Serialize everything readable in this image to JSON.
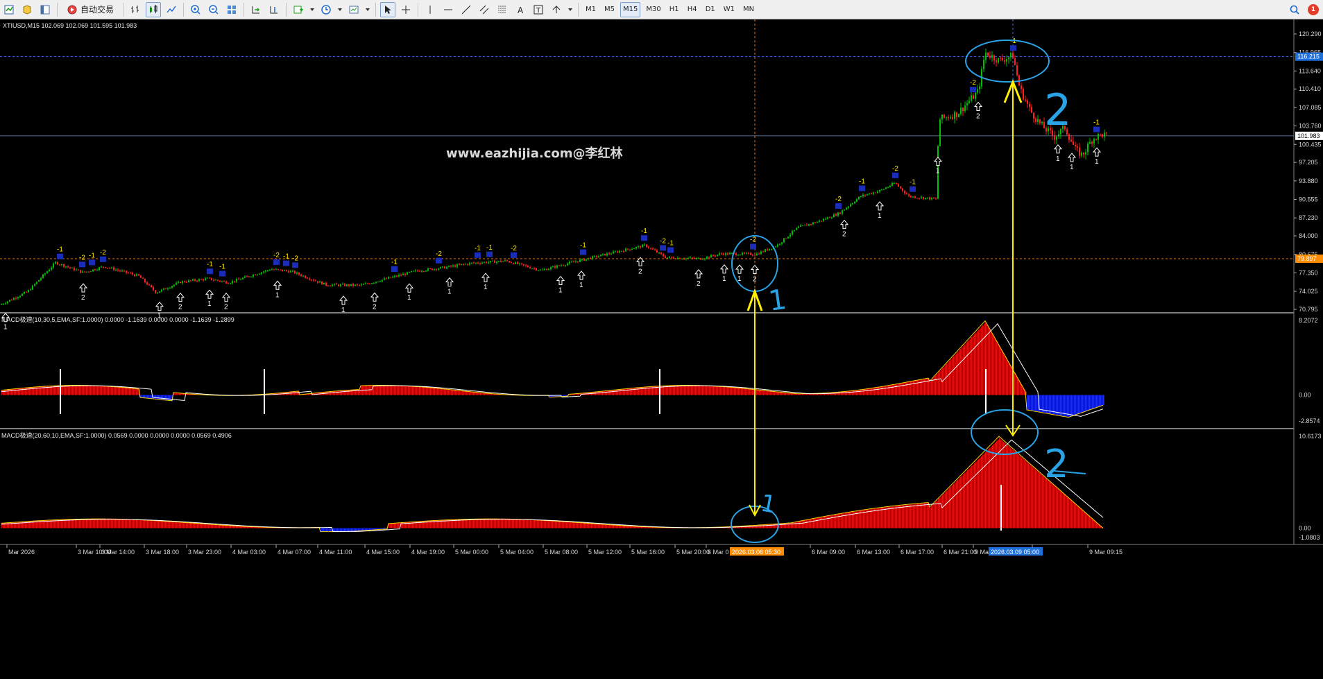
{
  "toolbar": {
    "auto_trade_label": "自动交易",
    "timeframes": [
      "M1",
      "M5",
      "M15",
      "M30",
      "H1",
      "H4",
      "D1",
      "W1",
      "MN"
    ],
    "active_timeframe": "M15",
    "alert_count": "1"
  },
  "chart": {
    "symbol_info": "XTIUSD,M15  102.069 102.069 101.595 101.983",
    "watermark": "www.eazhijia.com@李红林",
    "price_axis": [
      "120.290",
      "116.965",
      "113.640",
      "110.410",
      "107.085",
      "103.760",
      "100.435",
      "97.205",
      "93.880",
      "90.555",
      "87.230",
      "84.000",
      "80.675",
      "77.350",
      "74.025",
      "70.795"
    ],
    "current_price_tag": "101.983",
    "upper_line_tag": "116.215",
    "lower_line_tag": "79.897",
    "colors": {
      "bull": "#00c000",
      "bear": "#ff2020",
      "grid": "#2f4fa0",
      "axis_tag_blue": "#1e6fd9",
      "axis_tag_orange": "#ff8c00"
    }
  },
  "macd1": {
    "label": "MACD极速(10,30,5,EMA,SF:1.0000) 0.0000 -1.1639 0.0000 0.0000 -1.1639 -1.2899",
    "axis": [
      "8.2072",
      "0.00",
      "-2.8574"
    ]
  },
  "macd2": {
    "label": "MACD极速(20,60,10,EMA,SF:1.0000) 0.0569 0.0000 0.0000 0.0000 0.0569 0.4906",
    "axis": [
      "10.6173",
      "0.00",
      "-1.0803"
    ]
  },
  "time_axis": [
    "Mar 2026",
    "3 Mar 10:00",
    "3 Mar 14:00",
    "3 Mar 18:00",
    "3 Mar 23:00",
    "4 Mar 03:00",
    "4 Mar 07:00",
    "4 Mar 11:00",
    "4 Mar 15:00",
    "4 Mar 19:00",
    "5 Mar 00:00",
    "5 Mar 04:00",
    "5 Mar 08:00",
    "5 Mar 12:00",
    "5 Mar 16:00",
    "5 Mar 20:00",
    "6 Mar 0",
    "6 Mar 09:00",
    "6 Mar 13:00",
    "6 Mar 17:00",
    "6 Mar 21:00",
    "9 Ma",
    "15",
    "9 Mar 09:15"
  ],
  "time_highlights": [
    "2026.03.06 05:30",
    "2026.03.09 05:00"
  ],
  "annotations": {
    "arrow_labels": [
      "1",
      "2",
      "1",
      "2",
      "1",
      "2",
      "1",
      "1",
      "2",
      "1",
      "1",
      "1",
      "1",
      "1",
      "2",
      "2",
      "1",
      "1",
      "2",
      "2",
      "1",
      "1",
      "2",
      "1",
      "1",
      "1",
      "1",
      "1"
    ],
    "signal_labels": [
      "-1",
      "-2",
      "-1",
      "-2",
      "-1",
      "-1",
      "-2",
      "-1",
      "-2",
      "-1",
      "-2",
      "-1",
      "-1",
      "-2",
      "-1",
      "-1",
      "-2",
      "-1",
      "-2",
      "-2",
      "-1",
      "-2",
      "-1",
      "-2",
      "-1",
      "-1"
    ],
    "hand_marks": [
      "1",
      "2",
      "2",
      "2",
      "1"
    ]
  }
}
